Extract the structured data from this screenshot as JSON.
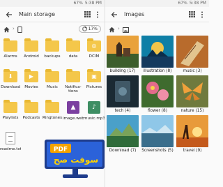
{
  "left": {
    "status": {
      "time": "5:38 PM",
      "battery": "67%"
    },
    "title": "Main storage",
    "zoom": "17%",
    "items": [
      {
        "label": "Alarms",
        "kind": "folder",
        "glyph": ""
      },
      {
        "label": "Android",
        "kind": "folder",
        "glyph": ""
      },
      {
        "label": "backups",
        "kind": "folder",
        "glyph": ""
      },
      {
        "label": "data",
        "kind": "folder",
        "glyph": ""
      },
      {
        "label": "DCIM",
        "kind": "folder",
        "glyph": "◎"
      },
      {
        "label": "Download",
        "kind": "folder",
        "glyph": "⬇"
      },
      {
        "label": "Movies",
        "kind": "folder",
        "glyph": "▶"
      },
      {
        "label": "Music",
        "kind": "folder",
        "glyph": ""
      },
      {
        "label": "Notifica-tions",
        "kind": "folder",
        "glyph": ""
      },
      {
        "label": "Pictures",
        "kind": "folder",
        "glyph": "▣"
      },
      {
        "label": "Playlists",
        "kind": "folder",
        "glyph": ""
      },
      {
        "label": "Podcasts",
        "kind": "folder",
        "glyph": ""
      },
      {
        "label": "Ringtones",
        "kind": "folder",
        "glyph": ""
      },
      {
        "label": "image.webp",
        "kind": "image",
        "glyph": "▲",
        "color": "#7b3fa0"
      },
      {
        "label": "music.mp3",
        "kind": "audio",
        "glyph": "♪",
        "color": "#3e8e63"
      },
      {
        "label": "readme.txt",
        "kind": "doc",
        "glyph": ""
      }
    ]
  },
  "right": {
    "status": {
      "time": "5:38 PM",
      "battery": "67%"
    },
    "title": "Images",
    "items": [
      {
        "label": "building (17)"
      },
      {
        "label": "illustration (8)"
      },
      {
        "label": "music (3)"
      },
      {
        "label": "tech (4)"
      },
      {
        "label": "flower (8)"
      },
      {
        "label": "nature (15)"
      },
      {
        "label": "Download (7)"
      },
      {
        "label": "Screenshots (5)"
      },
      {
        "label": "travel (9)"
      }
    ]
  },
  "watermark": {
    "badge": "PDF",
    "text": "سوفت صح"
  }
}
